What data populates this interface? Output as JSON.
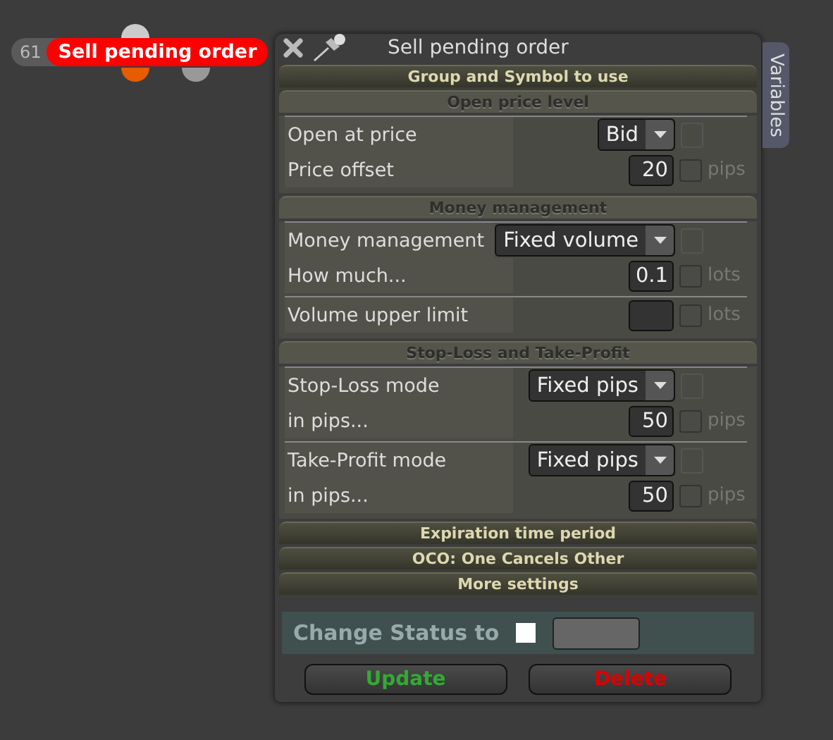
{
  "chart_label": {
    "number": "61",
    "text": "Sell pending order"
  },
  "window": {
    "title": "Sell pending order",
    "side_tab": "Variables"
  },
  "sections": [
    {
      "title": "Group and Symbol to use",
      "expanded": false
    },
    {
      "title": "Open price level",
      "expanded": true,
      "groups": [
        [
          {
            "kind": "select",
            "label": "Open at price",
            "value": "Bid",
            "disabled": true
          },
          {
            "kind": "number",
            "label": "Price offset",
            "value": "20",
            "unit": "pips",
            "checked": false
          }
        ]
      ]
    },
    {
      "title": "Money management",
      "expanded": true,
      "groups": [
        [
          {
            "kind": "select",
            "label": "Money management",
            "value": "Fixed volume",
            "disabled": true
          },
          {
            "kind": "number",
            "label": "How much...",
            "value": "0.1",
            "unit": "lots",
            "checked": false
          }
        ],
        [
          {
            "kind": "number",
            "label": "Volume upper limit",
            "unit": "lots",
            "checked": false
          }
        ]
      ]
    },
    {
      "title": "Stop-Loss and Take-Profit",
      "expanded": true,
      "groups": [
        [
          {
            "kind": "select",
            "label": "Stop-Loss mode",
            "value": "Fixed pips",
            "disabled": true
          },
          {
            "kind": "number",
            "label": "in pips...",
            "value": "50",
            "unit": "pips",
            "checked": false
          }
        ],
        [
          {
            "kind": "select",
            "label": "Take-Profit mode",
            "value": "Fixed pips",
            "disabled": true
          },
          {
            "kind": "number",
            "label": "in pips...",
            "value": "50",
            "unit": "pips",
            "checked": false
          }
        ]
      ]
    },
    {
      "title": "Expiration time period",
      "expanded": false
    },
    {
      "title": "OCO: One Cancels Other",
      "expanded": false
    },
    {
      "title": "More settings",
      "expanded": false
    }
  ],
  "status": {
    "label": "Change Status to",
    "checked": false
  },
  "buttons": [
    {
      "label": "Update",
      "kind": "confirm"
    },
    {
      "label": "Delete",
      "kind": "danger"
    }
  ]
}
